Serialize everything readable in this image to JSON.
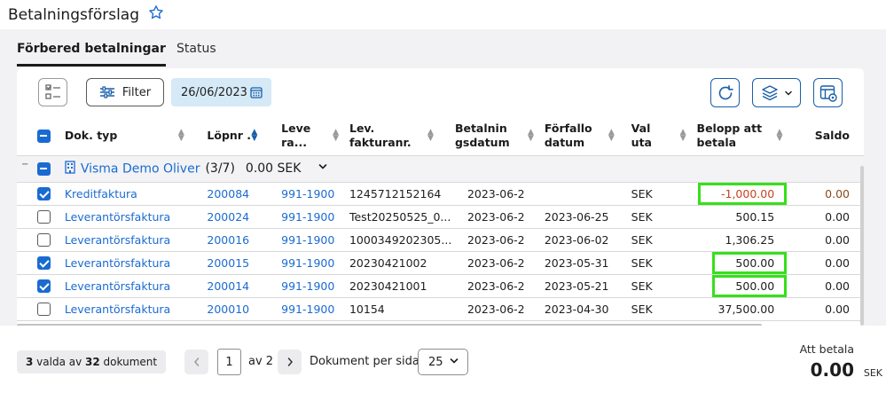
{
  "header": {
    "title": "Betalningsförslag",
    "favorite_icon": "star-outline-icon"
  },
  "tabs": [
    {
      "label": "Förbered betalningar",
      "active": true
    },
    {
      "label": "Status",
      "active": false
    }
  ],
  "toolbar": {
    "filter_label": "Filter",
    "date_value": "26/06/2023"
  },
  "table": {
    "columns": [
      {
        "key": "doc_type",
        "label": "Dok. typ"
      },
      {
        "key": "lopnr",
        "label": "Löpnr ."
      },
      {
        "key": "leverantor",
        "label": "Leve ra..."
      },
      {
        "key": "faktnr",
        "label": "Lev. fakturanr."
      },
      {
        "key": "betdatum",
        "label": "Betalnin gsdatum"
      },
      {
        "key": "forfallo",
        "label": "Förfallo datum"
      },
      {
        "key": "valuta",
        "label": "Val uta"
      },
      {
        "key": "belopp",
        "label": "Belopp att betala"
      },
      {
        "key": "saldo",
        "label": "Saldo"
      }
    ],
    "group": {
      "name": "Visma Demo Oliver",
      "count": "(3/7)",
      "sum": "0.00 SEK"
    },
    "rows": [
      {
        "checked": true,
        "doc_type": "Kreditfaktura",
        "lopnr": "200084",
        "leverantor": "991-1900",
        "faktnr": "1245712152164",
        "betdatum": "2023-06-2",
        "forfallo": "",
        "valuta": "SEK",
        "belopp": "-1,000.00",
        "saldo": "0.00",
        "highlight": true
      },
      {
        "checked": false,
        "doc_type": "Leverantörsfaktura",
        "lopnr": "200024",
        "leverantor": "991-1900",
        "faktnr": "Test20250525_0...",
        "betdatum": "2023-06-2",
        "forfallo": "2023-06-25",
        "valuta": "SEK",
        "belopp": "500.15",
        "saldo": "0.00",
        "highlight": false
      },
      {
        "checked": false,
        "doc_type": "Leverantörsfaktura",
        "lopnr": "200016",
        "leverantor": "991-1900",
        "faktnr": "1000349202305...",
        "betdatum": "2023-06-2",
        "forfallo": "2023-06-02",
        "valuta": "SEK",
        "belopp": "1,306.25",
        "saldo": "0.00",
        "highlight": false
      },
      {
        "checked": true,
        "doc_type": "Leverantörsfaktura",
        "lopnr": "200015",
        "leverantor": "991-1900",
        "faktnr": "20230421002",
        "betdatum": "2023-06-2",
        "forfallo": "2023-05-31",
        "valuta": "SEK",
        "belopp": "500.00",
        "saldo": "0.00",
        "highlight": true
      },
      {
        "checked": true,
        "doc_type": "Leverantörsfaktura",
        "lopnr": "200014",
        "leverantor": "991-1900",
        "faktnr": "20230421001",
        "betdatum": "2023-06-2",
        "forfallo": "2023-05-21",
        "valuta": "SEK",
        "belopp": "500.00",
        "saldo": "0.00",
        "highlight": true
      },
      {
        "checked": false,
        "doc_type": "Leverantörsfaktura",
        "lopnr": "200010",
        "leverantor": "991-1900",
        "faktnr": "10154",
        "betdatum": "2023-06-2",
        "forfallo": "2023-04-30",
        "valuta": "SEK",
        "belopp": "37,500.00",
        "saldo": "0.00",
        "highlight": false
      }
    ]
  },
  "footer": {
    "selected_count": "3",
    "selected_mid": " valda av ",
    "total_count": "32",
    "selected_suffix": " dokument",
    "page_current": "1",
    "page_of": "av 2",
    "per_page_label": "Dokument per sida",
    "per_page_value": "25",
    "pay_label": "Att betala",
    "pay_amount": "0.00",
    "pay_currency": "SEK"
  },
  "colors": {
    "accent": "#1a6bd1",
    "highlight": "#36e01a",
    "negative": "#c7431c"
  }
}
